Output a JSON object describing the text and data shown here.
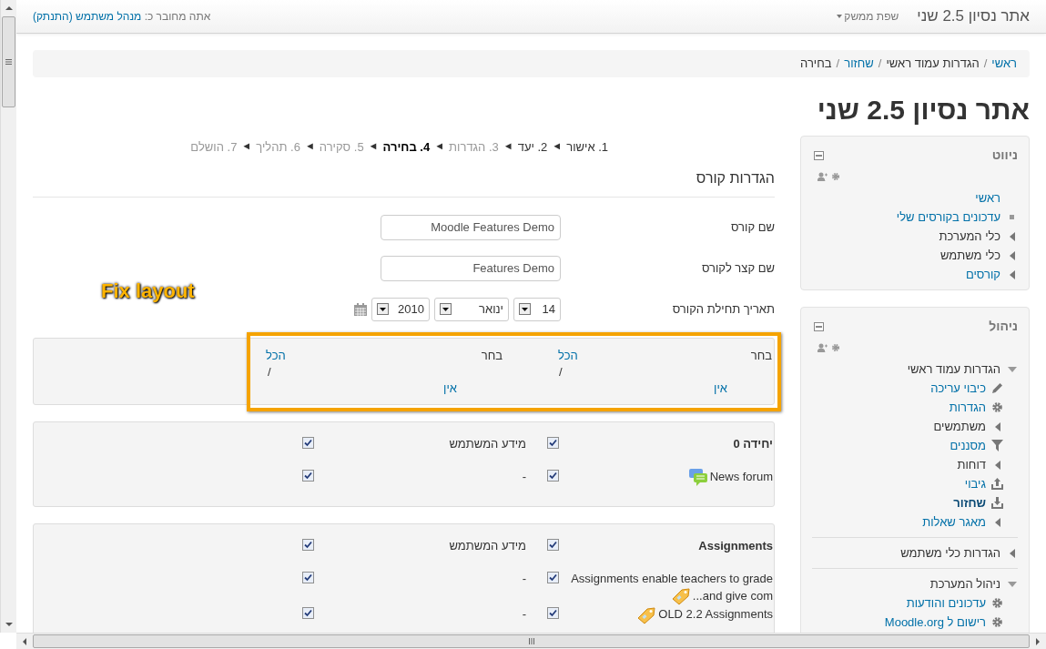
{
  "navbar": {
    "site_name": "אתר נסיון 2.5 שני",
    "language_menu": "שפת ממשק",
    "logged_in_prefix": "אתה מחובר כ:",
    "user_link": "מנהל משתמש",
    "logout_link": "(התנתק)"
  },
  "breadcrumb": [
    {
      "label": "ראשי",
      "link": true
    },
    {
      "label": "הגדרות עמוד ראשי",
      "link": false
    },
    {
      "label": "שחזור",
      "link": true
    },
    {
      "label": "בחירה",
      "link": false
    }
  ],
  "breadcrumb_separator": "/",
  "page_title": "אתר נסיון 2.5 שני",
  "steps": [
    {
      "label": "1. אישור",
      "done": true,
      "selected": false
    },
    {
      "label": "2. יעד",
      "done": true,
      "selected": false
    },
    {
      "label": "3. הגדרות",
      "done": false,
      "selected": false
    },
    {
      "label": "4. בחירה",
      "done": false,
      "selected": true
    },
    {
      "label": "5. סקירה",
      "done": false,
      "selected": false
    },
    {
      "label": "6. תהליך",
      "done": false,
      "selected": false
    },
    {
      "label": "7. הושלם",
      "done": false,
      "selected": false
    }
  ],
  "step_separator": "◄",
  "form": {
    "heading": "הגדרות קורס",
    "fields": [
      {
        "label": "שם קורס",
        "value": "Moodle Features Demo"
      },
      {
        "label": "שם קצר לקורס",
        "value": "Features Demo"
      }
    ],
    "date": {
      "label": "תאריך תחילת הקורס",
      "day": "14",
      "month": "ינואר",
      "year": "2010"
    }
  },
  "annotation": {
    "text": "Fix layout"
  },
  "selectors": [
    {
      "label": "בחר",
      "all": "הכל",
      "separator": "/",
      "none": "אין"
    },
    {
      "label": "בחר",
      "all": "הכל",
      "separator": "/",
      "none": "אין"
    }
  ],
  "sections": [
    {
      "rows": [
        {
          "kind": "section",
          "label": "יחידה 0",
          "included": true,
          "userinfo_label": "מידע המשתמש",
          "userinfo": true
        },
        {
          "kind": "forum",
          "label": "News forum",
          "included": true,
          "userinfo_label": "-",
          "userinfo": true
        }
      ]
    },
    {
      "rows": [
        {
          "kind": "section",
          "label": "Assignments",
          "included": true,
          "userinfo_label": "מידע המשתמש",
          "userinfo": true
        },
        {
          "kind": "assignment",
          "label": "Assignments enable teachers to grade and give com...",
          "included": true,
          "userinfo_label": "-",
          "userinfo": true
        },
        {
          "kind": "assignment",
          "label": "OLD 2.2 Assignments",
          "included": true,
          "userinfo_label": "-",
          "userinfo": true
        }
      ]
    }
  ],
  "blocks": [
    {
      "title": "ניווט",
      "items": [
        {
          "kind": "plain",
          "label": "ראשי",
          "link": true,
          "selected": false
        },
        {
          "kind": "bullet",
          "label": "עדכונים בקורסים שלי",
          "link": true,
          "selected": false
        },
        {
          "kind": "branch",
          "label": "כלי המערכת",
          "link": false,
          "selected": false,
          "expanded": false
        },
        {
          "kind": "branch",
          "label": "כלי משתמש",
          "link": false,
          "selected": false,
          "expanded": false
        },
        {
          "kind": "branch",
          "label": "קורסים",
          "link": true,
          "selected": false,
          "expanded": false
        }
      ]
    },
    {
      "title": "ניהול",
      "items": [
        {
          "kind": "branch",
          "label": "הגדרות עמוד ראשי",
          "link": false,
          "selected": false,
          "expanded": true,
          "children": [
            {
              "kind": "pencil",
              "label": "כיבוי עריכה",
              "link": true,
              "selected": false
            },
            {
              "kind": "gear",
              "label": "הגדרות",
              "link": true,
              "selected": false
            },
            {
              "kind": "branch",
              "label": "משתמשים",
              "link": false,
              "selected": false,
              "expanded": false
            },
            {
              "kind": "filter",
              "label": "מסננים",
              "link": true,
              "selected": false
            },
            {
              "kind": "branch",
              "label": "דוחות",
              "link": false,
              "selected": false,
              "expanded": false
            },
            {
              "kind": "upload",
              "label": "גיבוי",
              "link": true,
              "selected": false
            },
            {
              "kind": "download",
              "label": "שחזור",
              "link": true,
              "selected": true
            },
            {
              "kind": "branch",
              "label": "מאגר שאלות",
              "link": true,
              "selected": false,
              "expanded": false
            }
          ]
        },
        {
          "kind": "branch",
          "label": "הגדרות כלי משתמש",
          "link": false,
          "selected": false,
          "expanded": false,
          "divider": true
        },
        {
          "kind": "branch",
          "label": "ניהול המערכת",
          "link": false,
          "selected": false,
          "expanded": true,
          "divider": true,
          "children": [
            {
              "kind": "gear",
              "label": "עדכונים והודעות",
              "link": true,
              "selected": false
            },
            {
              "kind": "gear",
              "label": "רישום ל Moodle.org",
              "link": true,
              "selected": false
            }
          ]
        }
      ]
    }
  ]
}
